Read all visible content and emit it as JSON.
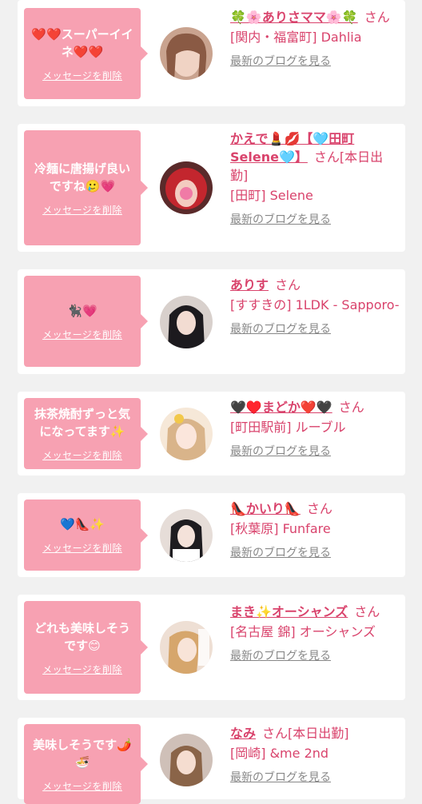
{
  "delete_label": "メッセージを削除",
  "blog_label": "最新のブログを見る",
  "items": [
    {
      "message": "❤️❤️スーパーイイネ❤️❤️",
      "name": "🍀🌸ありさママ🌸🍀",
      "suffix": "さん",
      "shop": "[関内・福富町] Dahlia"
    },
    {
      "message": "冷麺に唐揚げ良いですね🥲💗",
      "name": "かえで💄💋【🩵田町Selene🩵】",
      "suffix": "さん[本日出勤]",
      "shop": "[田町] Selene"
    },
    {
      "message": "🐈‍⬛💗",
      "name": "ありす",
      "suffix": "さん",
      "shop": "[すすきの] 1LDK - Sapporo-"
    },
    {
      "message": "抹茶焼酎ずっと気になってます✨",
      "name": "🖤♥️まどか❤️🖤",
      "suffix": "さん",
      "shop": "[町田駅前] ルーブル"
    },
    {
      "message": "💙👠✨",
      "name": "👠かいり👠",
      "suffix": "さん",
      "shop": "[秋葉原] Funfare"
    },
    {
      "message": "どれも美味しそうです😊",
      "name": "まき✨オーシャンズ",
      "suffix": "さん",
      "shop": "[名古屋 錦] オーシャンズ"
    },
    {
      "message": "美味しそうです🌶️🍜",
      "name": "なみ",
      "suffix": "さん[本日出勤]",
      "shop": "[岡崎] &me 2nd"
    }
  ],
  "colors": {
    "accent": "#f7a1b2",
    "link": "#d9436c",
    "muted": "#888888"
  }
}
